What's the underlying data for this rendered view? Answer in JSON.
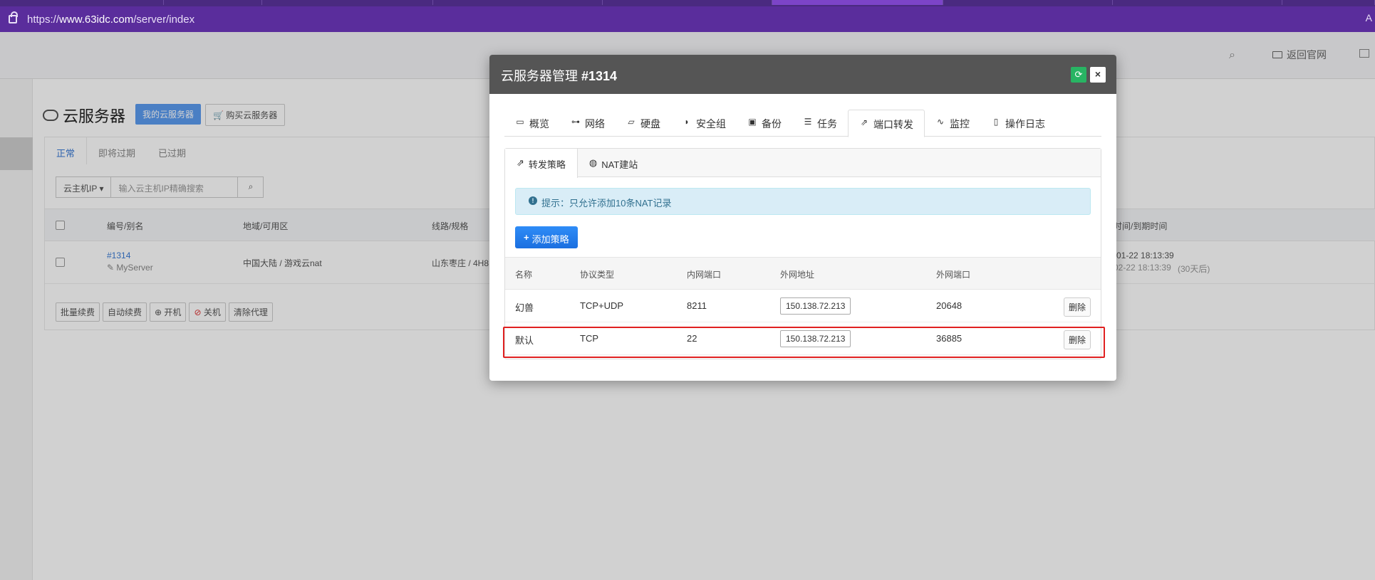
{
  "browser": {
    "url_prefix": "https://",
    "url_host": "www.63idc.com",
    "url_path": "/server/index",
    "right_glyph": "A"
  },
  "page": {
    "header": {
      "back_label": "返回官网"
    },
    "title": "云服务器",
    "btn_my_servers": "我的云服务器",
    "btn_buy": "购买云服务器",
    "status_tabs": [
      "正常",
      "即将过期",
      "已过期"
    ],
    "filter": {
      "select_label": "云主机IP",
      "search_placeholder": "输入云主机IP精确搜索"
    },
    "table_headers": [
      "编号/别名",
      "地域/可用区",
      "线路/规格",
      "时间/到期时间"
    ],
    "row": {
      "id": "#1314",
      "alias": "MyServer",
      "region": "中国大陆 / 游戏云nat",
      "line": "山东枣庄 / 4H8",
      "time1": "-01-22 18:13:39",
      "time2": "02-22 18:13:39",
      "remain": "(30天后)"
    },
    "actions": [
      "批量续费",
      "自动续费",
      "开机",
      "关机",
      "清除代理"
    ]
  },
  "modal": {
    "title": "云服务器管理",
    "server_id": "#1314",
    "tabs": [
      {
        "label": "概览",
        "icon": "monitor-icon",
        "glyph": "▭"
      },
      {
        "label": "网络",
        "icon": "sitemap-icon",
        "glyph": "⊶"
      },
      {
        "label": "硬盘",
        "icon": "hdd-icon",
        "glyph": "▱"
      },
      {
        "label": "安全组",
        "icon": "shield-icon",
        "glyph": "◗"
      },
      {
        "label": "备份",
        "icon": "floppy-icon",
        "glyph": "▣"
      },
      {
        "label": "任务",
        "icon": "tasks-icon",
        "glyph": "☰"
      },
      {
        "label": "端口转发",
        "icon": "external-link-icon",
        "glyph": "⇗"
      },
      {
        "label": "监控",
        "icon": "heartbeat-icon",
        "glyph": "∿"
      },
      {
        "label": "操作日志",
        "icon": "file-icon",
        "glyph": "▯"
      }
    ],
    "active_tab": "端口转发",
    "sub_tabs": [
      {
        "label": "转发策略",
        "icon": "external-link-icon",
        "glyph": "⇗"
      },
      {
        "label": "NAT建站",
        "icon": "globe-icon",
        "glyph": "◍"
      }
    ],
    "alert_text": "提示：只允许添加10条NAT记录",
    "add_button": "添加策略",
    "table": {
      "headers": [
        "名称",
        "协议类型",
        "内网端口",
        "外网地址",
        "外网端口"
      ],
      "rows": [
        {
          "name": "幻兽",
          "protocol": "TCP+UDP",
          "internal_port": "8211",
          "external_ip": "150.138.72.213",
          "external_port": "20648",
          "action": "删除"
        },
        {
          "name": "默认",
          "protocol": "TCP",
          "internal_port": "22",
          "external_ip": "150.138.72.213",
          "external_port": "36885",
          "action": "删除"
        }
      ]
    }
  },
  "colors": {
    "browser_purple": "#5a2d9c",
    "modal_header": "#555555",
    "primary": "#1a6fe0",
    "success": "#28b463",
    "alert_bg": "#d9edf7",
    "highlight": "#e02020"
  }
}
